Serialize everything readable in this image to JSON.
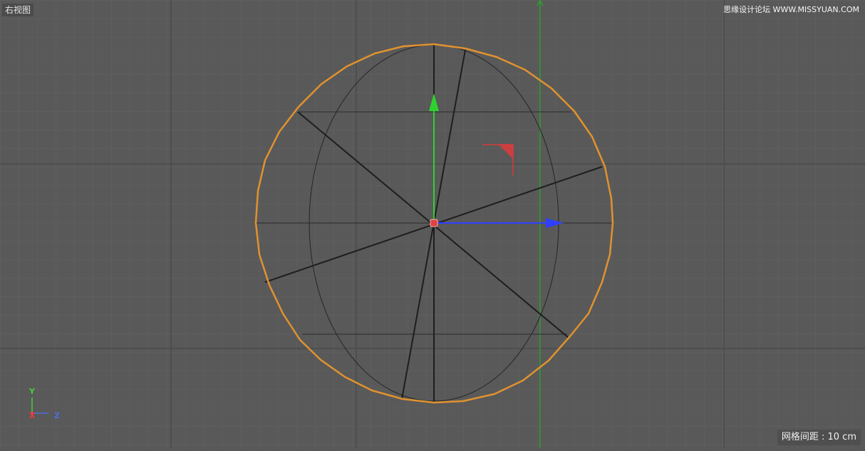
{
  "viewport": {
    "view_name": "右视图",
    "watermark": "思缘设计论坛 WWW.MISSYUAN.COM",
    "grid_spacing_label": "网格间距 : 10 cm"
  },
  "axis_indicator": {
    "y": "Y",
    "x": "X",
    "z": "Z"
  },
  "colors": {
    "background": "#595959",
    "selection_outline": "#e0922f",
    "y_axis": "#2fd12f",
    "z_axis": "#2f3fff",
    "x_axis": "#e04040"
  }
}
